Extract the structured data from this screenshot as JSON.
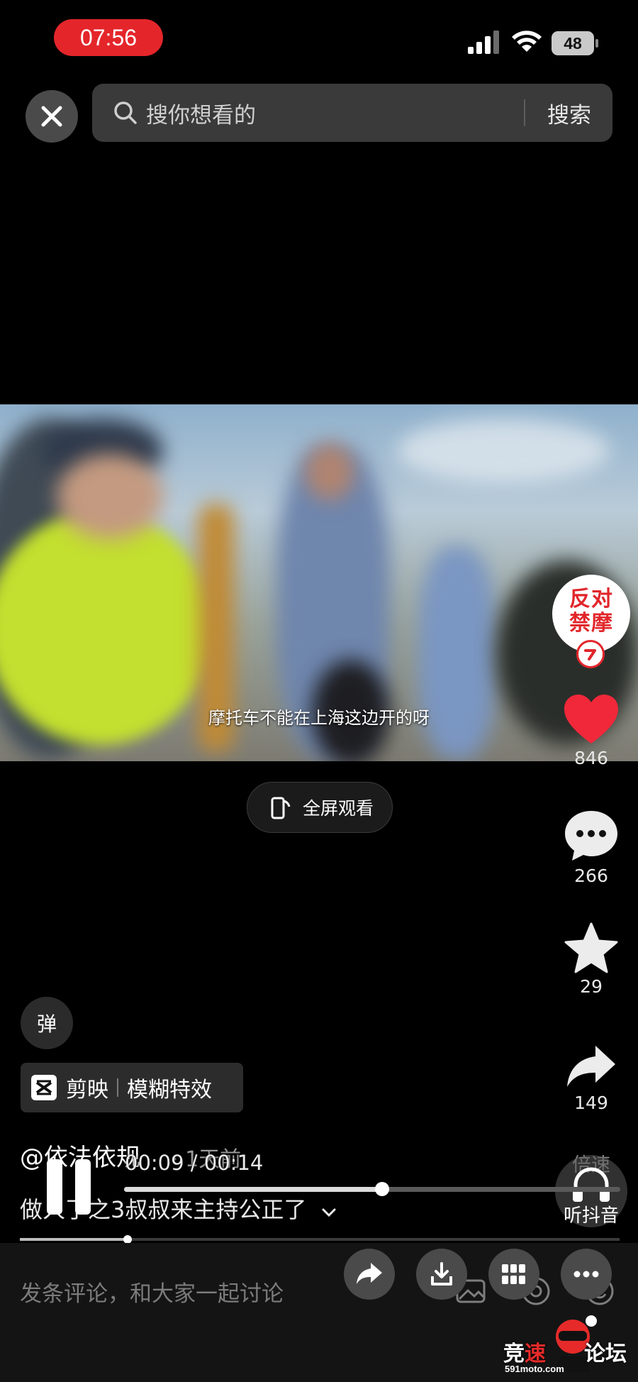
{
  "status_bar": {
    "time": "07:56",
    "battery": "48"
  },
  "search": {
    "placeholder": "搜你想看的",
    "submit_label": "搜索"
  },
  "video": {
    "subtitle": "摩托车不能在上海这边开的呀"
  },
  "fullscreen": {
    "label": "全屏观看"
  },
  "author_avatar": {
    "text_line1": "反对",
    "text_line2": "禁摩"
  },
  "actions": {
    "likes": "846",
    "comments": "266",
    "favorites": "29",
    "shares": "149"
  },
  "danmaku": {
    "label": "弹"
  },
  "effect_tag": {
    "app": "剪映",
    "effect": "模糊特效"
  },
  "post": {
    "author": "@依法依规",
    "time_ago": "· 1天前",
    "description": "做人了之3叔叔来主持公正了",
    "playback_time": "00:09 / 00:14",
    "progress": 0.52
  },
  "player": {
    "speed_label": "倍速",
    "listen_label": "听抖音"
  },
  "comment_bar": {
    "placeholder": "发条评论，和大家一起讨论"
  },
  "watermark": {
    "text_part1": "竞",
    "text_part2": "速",
    "text_part3": "论坛",
    "site": "591moto.com"
  },
  "colors": {
    "like_red": "#f0283a",
    "status_pill": "#e4262b",
    "background": "#000000"
  }
}
